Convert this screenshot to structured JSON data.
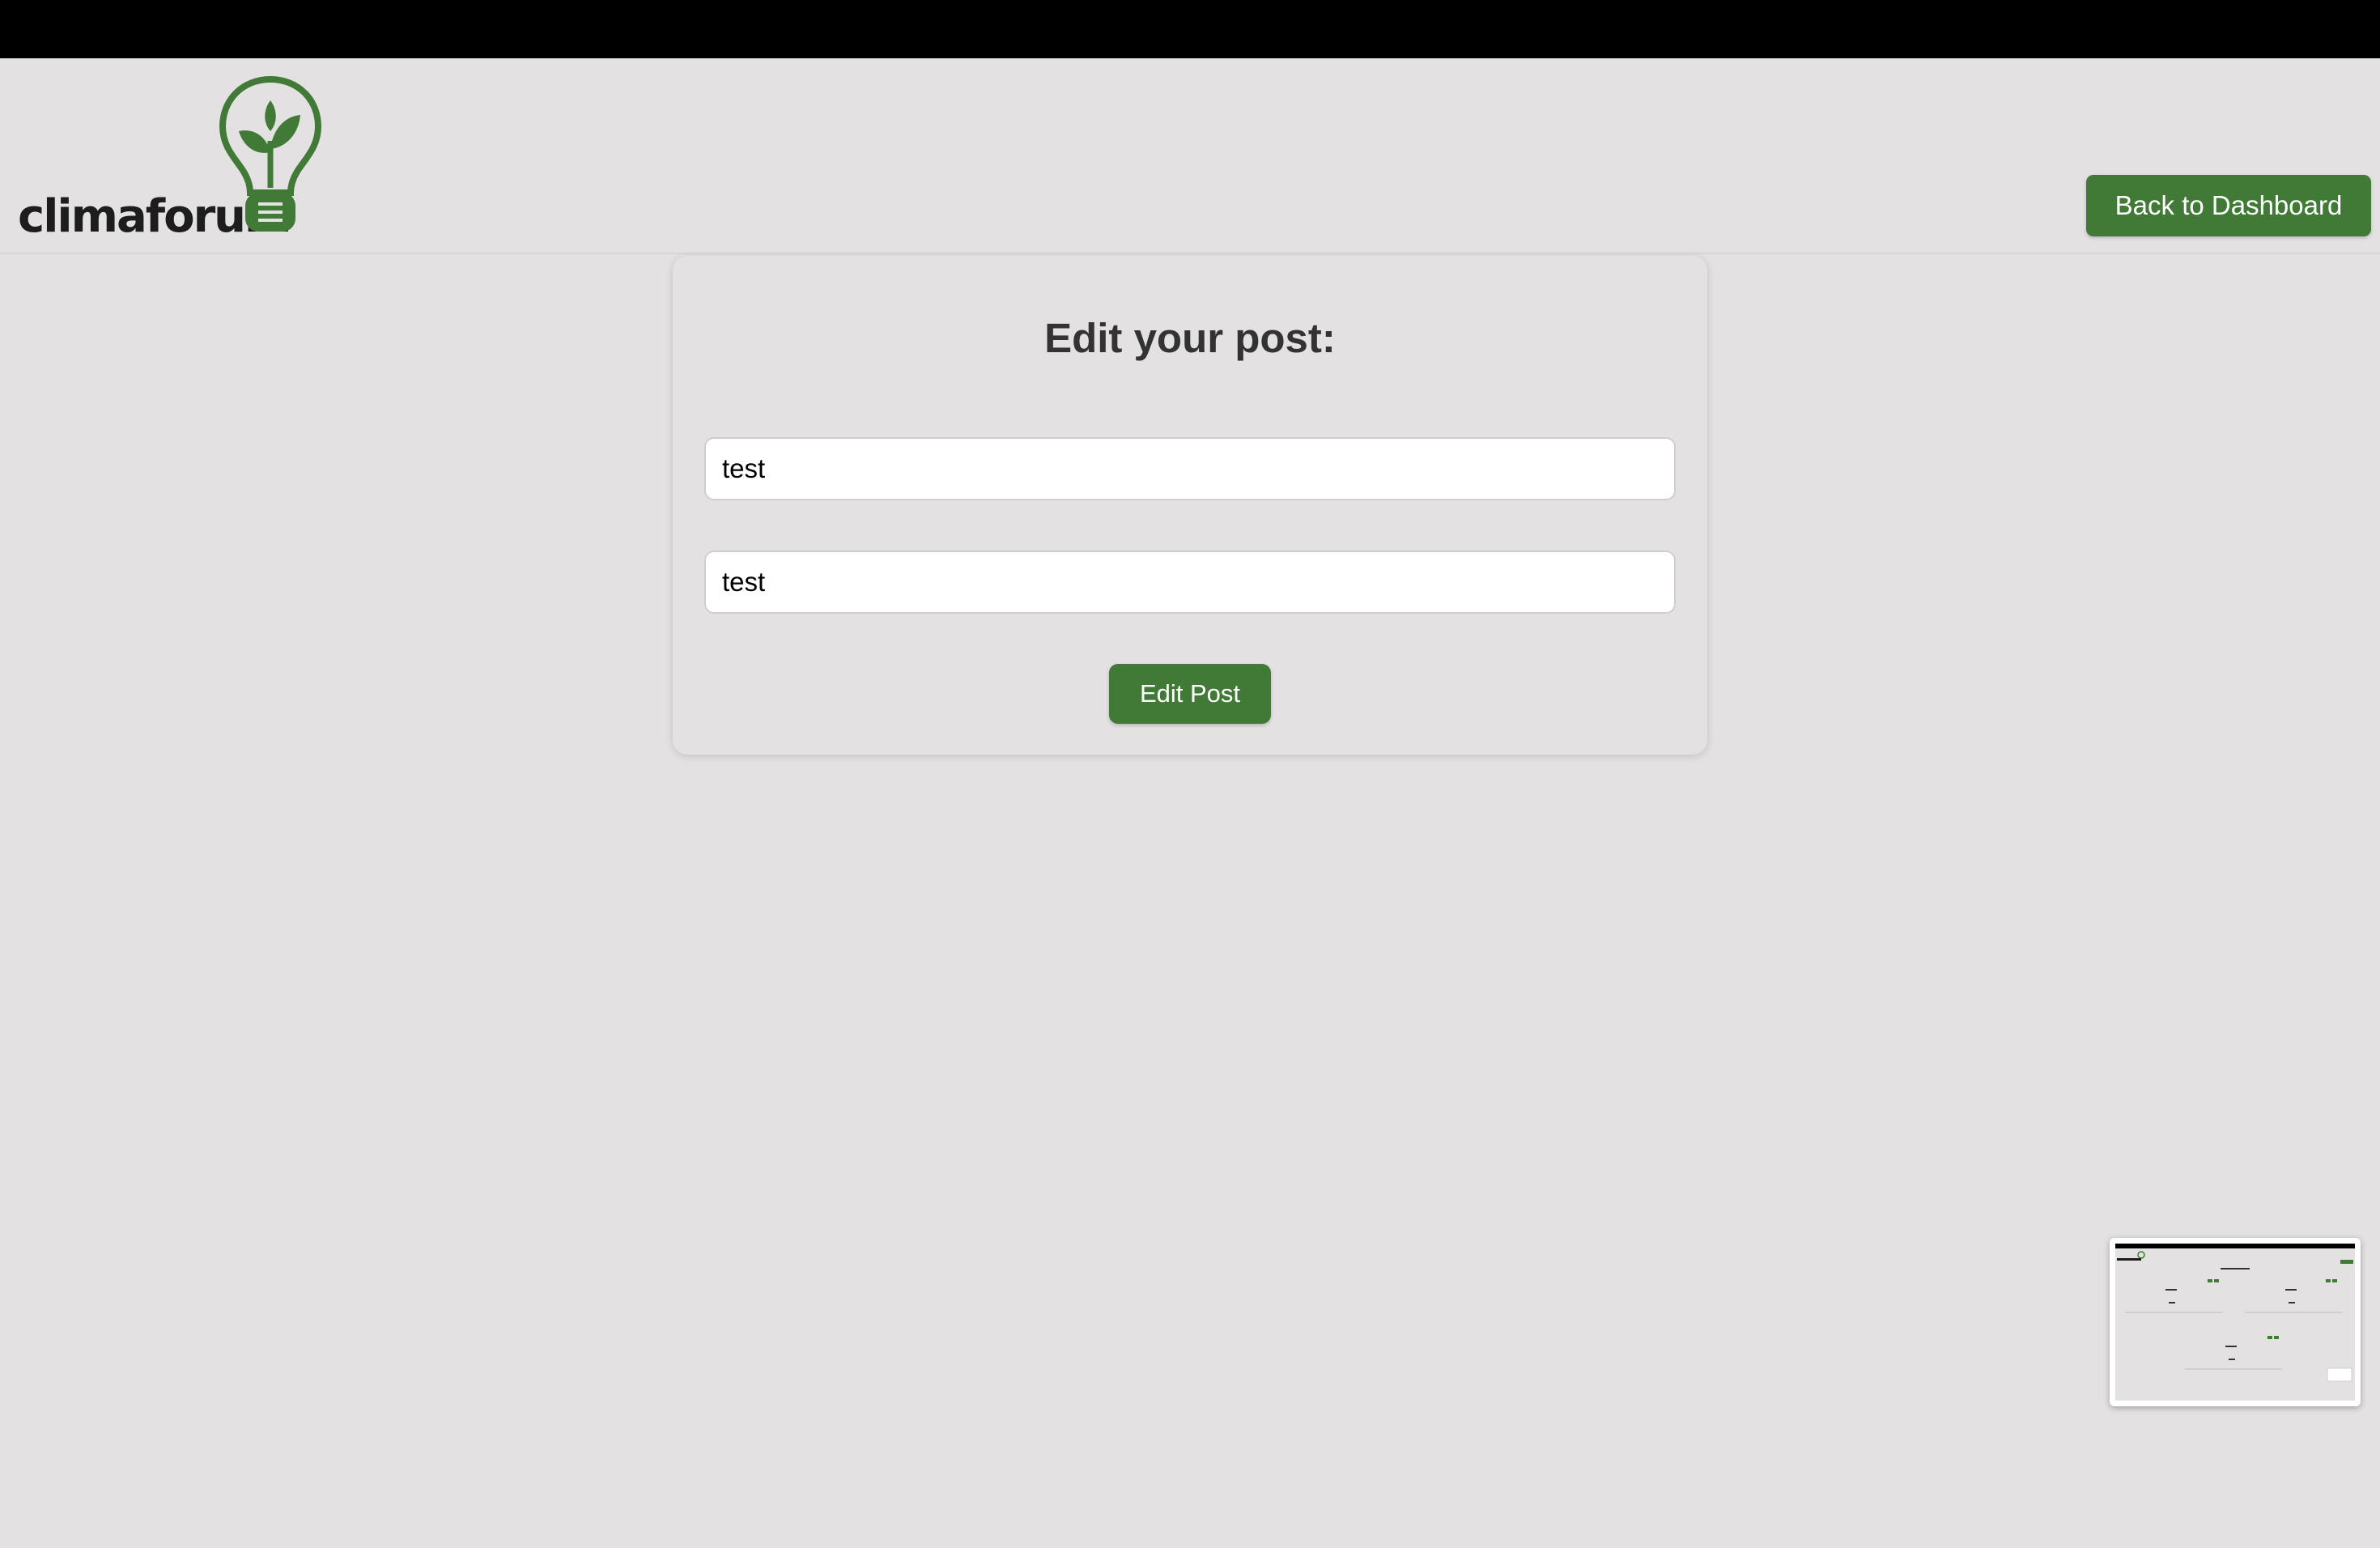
{
  "header": {
    "logo_text": "climaforum",
    "back_button_label": "Back to Dashboard"
  },
  "form": {
    "title": "Edit your post:",
    "post_title_value": "test",
    "post_content_value": "test",
    "submit_label": "Edit Post"
  },
  "colors": {
    "brand_green": "#417a36",
    "background": "#e3e1e2"
  },
  "icons": {
    "logo": "lightbulb-leaf-icon"
  }
}
